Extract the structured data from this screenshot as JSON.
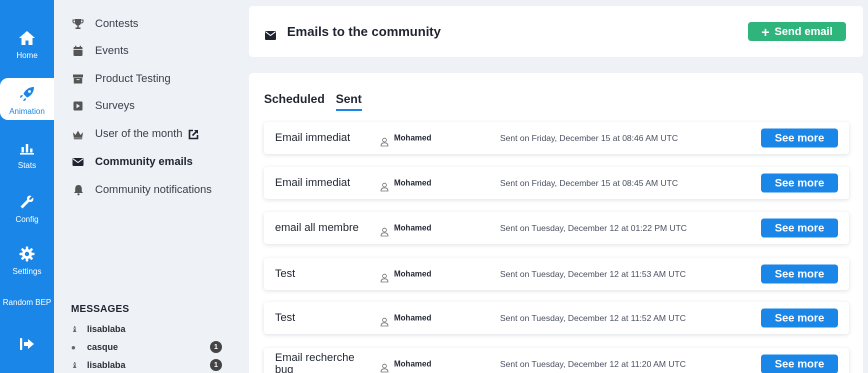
{
  "rail": {
    "items": [
      {
        "label": "Home",
        "icon": "home-icon"
      },
      {
        "label": "Animation",
        "icon": "rocket-icon"
      },
      {
        "label": "Stats",
        "icon": "bar-chart-icon"
      },
      {
        "label": "Config",
        "icon": "wrench-icon"
      },
      {
        "label": "Settings",
        "icon": "gear-icon"
      },
      {
        "label": "Random BEP",
        "icon": ""
      },
      {
        "label": "",
        "icon": "logout-icon"
      }
    ],
    "active": "Animation"
  },
  "menu": {
    "items": [
      {
        "label": "Contests",
        "icon": "trophy-icon"
      },
      {
        "label": "Events",
        "icon": "calendar-icon"
      },
      {
        "label": "Product Testing",
        "icon": "box-icon"
      },
      {
        "label": "Surveys",
        "icon": "survey-icon"
      },
      {
        "label": "User of the month",
        "icon": "crown-icon"
      },
      {
        "label": "Community emails",
        "icon": "envelope-icon"
      },
      {
        "label": "Community notifications",
        "icon": "bell-icon"
      }
    ],
    "active": "Community emails"
  },
  "messages": {
    "title": "MESSAGES",
    "items": [
      {
        "name": "lisablaba",
        "badge": ""
      },
      {
        "name": "casque",
        "badge": "1"
      },
      {
        "name": "lisablaba",
        "badge": "1"
      }
    ]
  },
  "header": {
    "title": "Emails to the community",
    "send_button": "Send email"
  },
  "tabs": [
    {
      "label": "Scheduled"
    },
    {
      "label": "Sent"
    }
  ],
  "active_tab": "Sent",
  "emails": [
    {
      "subject": "Email immediat",
      "author": "Mohamed",
      "sent": "Sent on Friday, December 15 at 08:46 AM UTC",
      "action": "See more"
    },
    {
      "subject": "Email immediat",
      "author": "Mohamed",
      "sent": "Sent on Friday, December 15 at 08:45 AM UTC",
      "action": "See more"
    },
    {
      "subject": "email all membre",
      "author": "Mohamed",
      "sent": "Sent on Tuesday, December 12 at 01:22 PM UTC",
      "action": "See more"
    },
    {
      "subject": "Test",
      "author": "Mohamed",
      "sent": "Sent on Tuesday, December 12 at 11:53 AM UTC",
      "action": "See more"
    },
    {
      "subject": "Test",
      "author": "Mohamed",
      "sent": "Sent on Tuesday, December 12 at 11:52 AM UTC",
      "action": "See more"
    },
    {
      "subject": "Email recherche bug",
      "author": "Mohamed",
      "sent": "Sent on Tuesday, December 12 at 11:20 AM UTC",
      "action": "See more"
    }
  ],
  "colors": {
    "primary": "#1a86e8",
    "success": "#2fb47c",
    "background": "#eef1f6"
  }
}
